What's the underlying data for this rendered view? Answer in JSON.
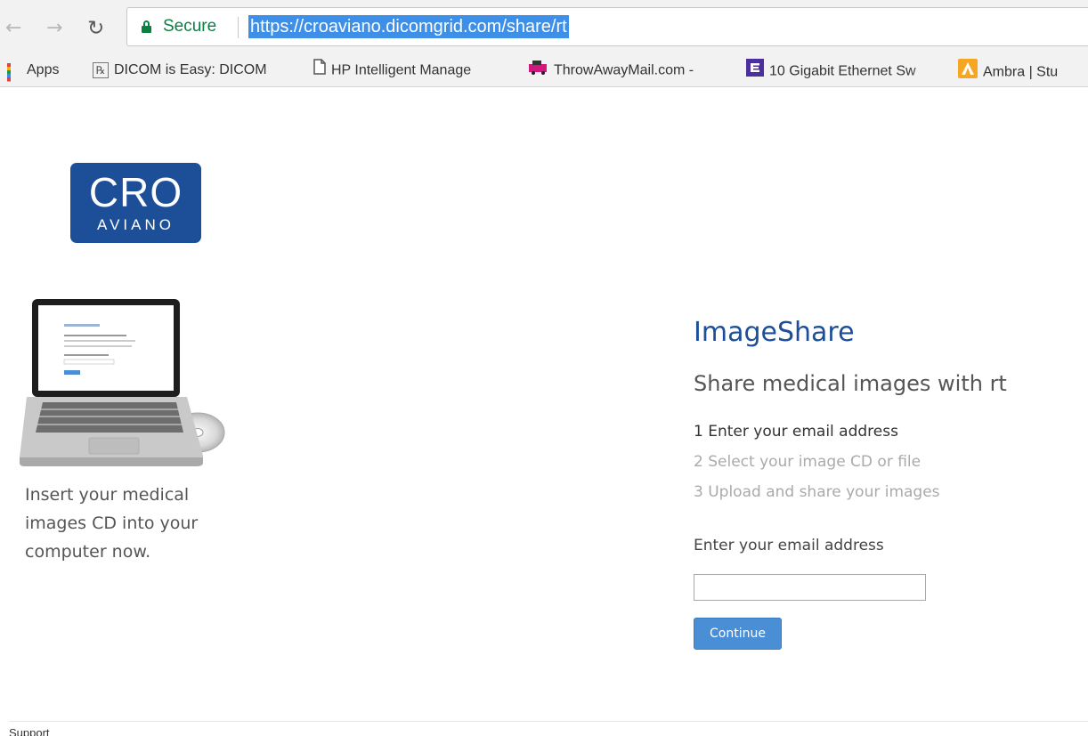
{
  "browser": {
    "nav": {
      "back_icon": "arrow-left-icon",
      "forward_icon": "arrow-right-icon",
      "reload_icon": "reload-icon"
    },
    "omnibox": {
      "security_label": "Secure",
      "url": "https://croaviano.dicomgrid.com/share/rt"
    },
    "bookmarks": [
      {
        "label": "Apps",
        "icon": "apps-grid-icon"
      },
      {
        "label": "DICOM is Easy: DICOM",
        "icon": "rx-icon"
      },
      {
        "label": "HP Intelligent Manage",
        "icon": "page-icon"
      },
      {
        "label": "ThrowAwayMail.com -",
        "icon": "mail-truck-icon"
      },
      {
        "label": "10 Gigabit Ethernet Sw",
        "icon": "e-logo-icon"
      },
      {
        "label": "Ambra | Stu",
        "icon": "ambra-triangle-icon"
      }
    ]
  },
  "logo": {
    "main": "CRO",
    "sub": "AVIANO"
  },
  "left_panel": {
    "instruction": "Insert your medical images CD into your computer now."
  },
  "main": {
    "title": "ImageShare",
    "subtitle": "Share medical images with rt",
    "steps": [
      "1 Enter your email address",
      "2 Select your image CD or file",
      "3 Upload and share your images"
    ],
    "email_label": "Enter your email address",
    "email_value": "",
    "continue_label": "Continue"
  },
  "footer": {
    "support_label": "Support"
  },
  "colors": {
    "brand": "#1d4f98",
    "button": "#4a8fd6",
    "secure": "#0b8043",
    "url_highlight": "#3d8fe8"
  }
}
